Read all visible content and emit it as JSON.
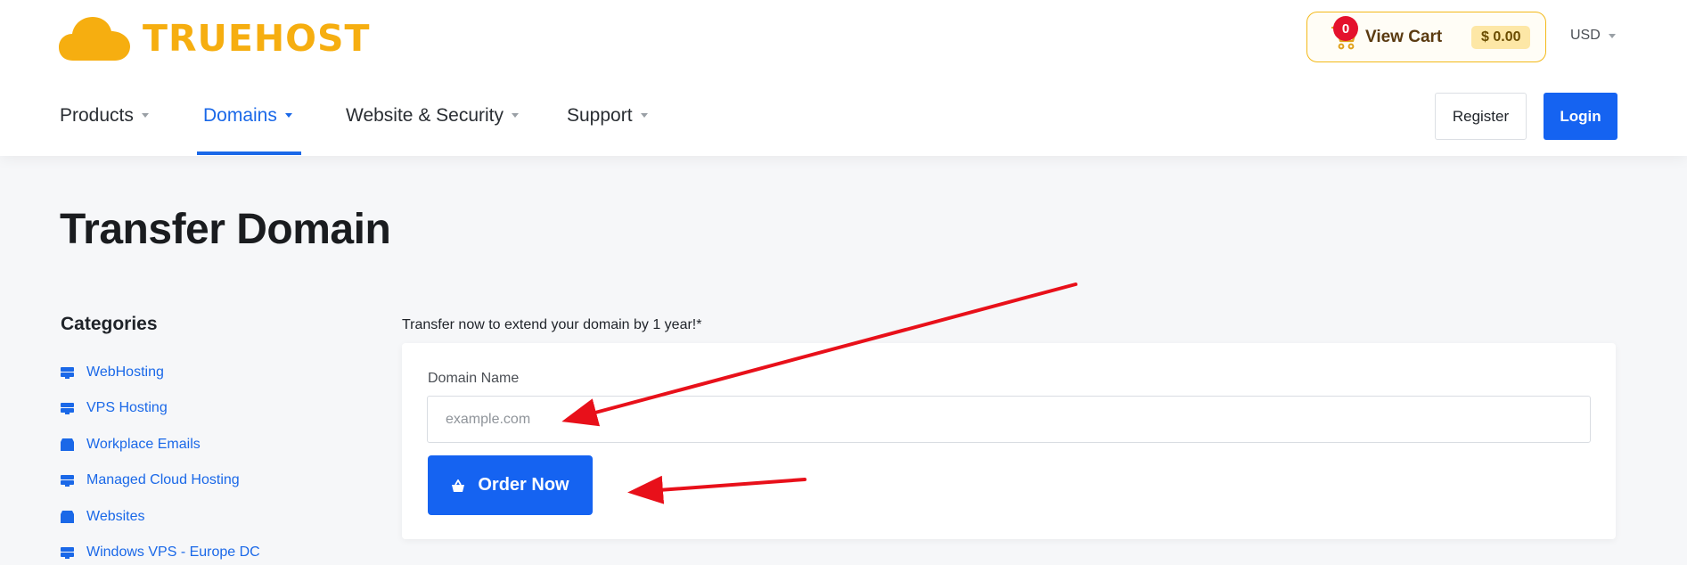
{
  "brand": {
    "name": "TRUEHOST",
    "color": "#f6ae10"
  },
  "cart": {
    "count": "0",
    "label": "View Cart",
    "price": "$ 0.00"
  },
  "currency": {
    "selected": "USD"
  },
  "nav": {
    "items": [
      {
        "label": "Products",
        "active": false
      },
      {
        "label": "Domains",
        "active": true
      },
      {
        "label": "Website & Security",
        "active": false
      },
      {
        "label": "Support",
        "active": false
      }
    ]
  },
  "auth": {
    "register_label": "Register",
    "login_label": "Login"
  },
  "page": {
    "title": "Transfer Domain"
  },
  "sidebar": {
    "title": "Categories",
    "items": [
      {
        "label": "WebHosting",
        "icon": "server-icon"
      },
      {
        "label": "VPS Hosting",
        "icon": "server-icon"
      },
      {
        "label": "Workplace Emails",
        "icon": "box-icon"
      },
      {
        "label": "Managed Cloud Hosting",
        "icon": "server-icon"
      },
      {
        "label": "Websites",
        "icon": "box-icon"
      },
      {
        "label": "Windows VPS - Europe DC",
        "icon": "server-icon"
      }
    ]
  },
  "transfer": {
    "note": "Transfer now to extend your domain by 1 year!*",
    "field_label": "Domain Name",
    "input_value": "",
    "placeholder": "example.com",
    "order_label": "Order Now"
  },
  "colors": {
    "accent": "#1563f1",
    "link": "#1a68e8",
    "badge": "#e4112d",
    "annotation_arrow": "#e8101a"
  }
}
